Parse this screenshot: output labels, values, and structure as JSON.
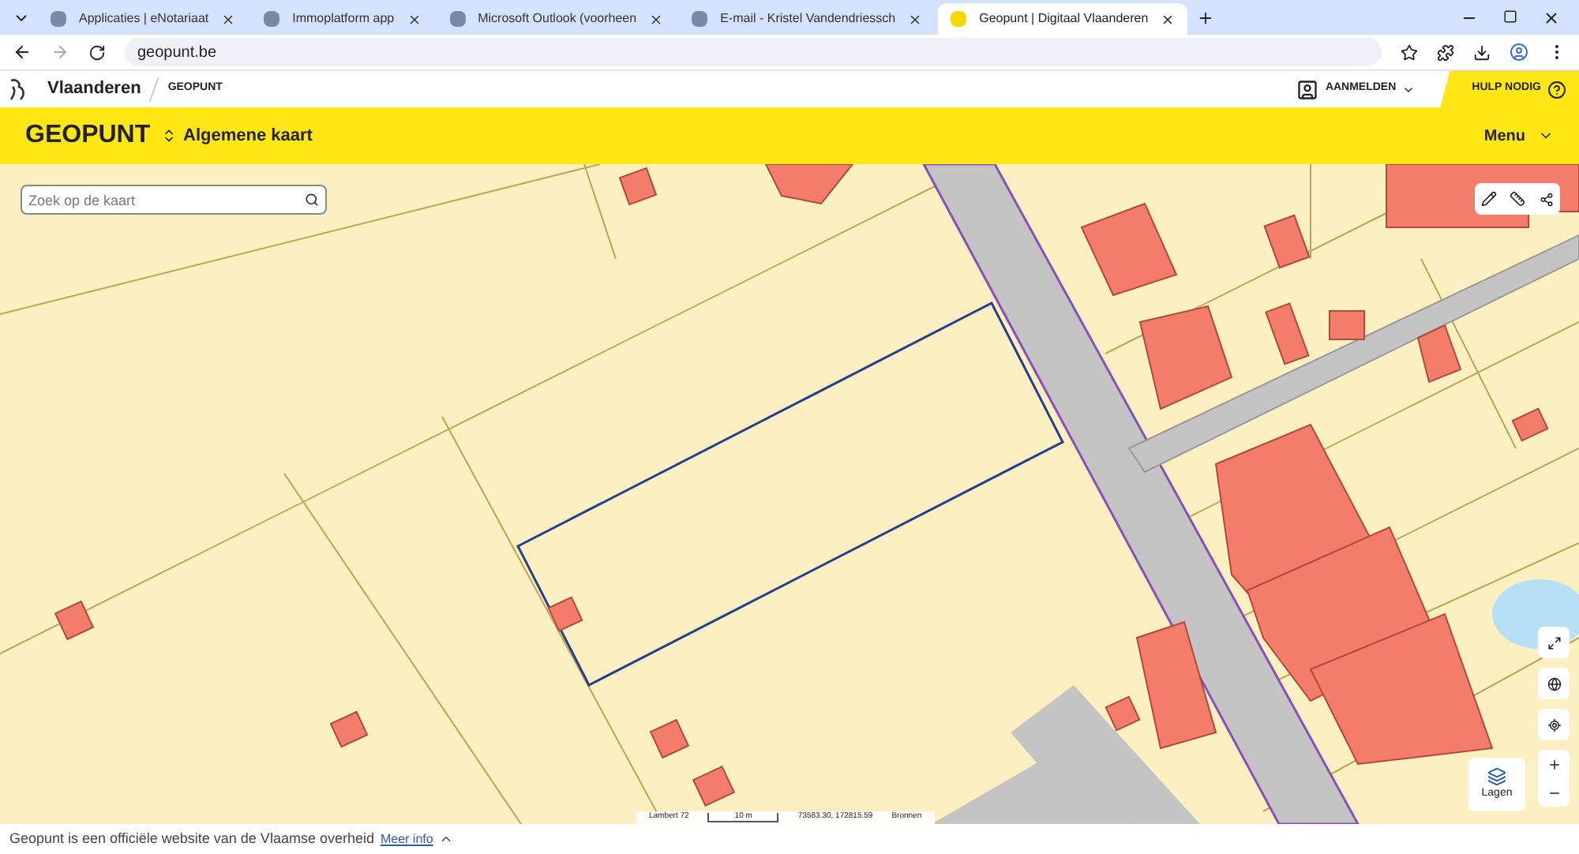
{
  "browser": {
    "tabs": [
      {
        "title": "Applicaties | eNotariaat",
        "selected": false
      },
      {
        "title": "Immoplatform app",
        "selected": false
      },
      {
        "title": "Microsoft Outlook (voorheen",
        "selected": false
      },
      {
        "title": "E-mail - Kristel Vandendriessch",
        "selected": false
      },
      {
        "title": "Geopunt | Digitaal Vlaanderen",
        "selected": true
      }
    ],
    "address": "geopunt.be"
  },
  "site_header": {
    "brand": "Vlaanderen",
    "site": "GEOPUNT",
    "login": "AANMELDEN",
    "help": "HULP NODIG"
  },
  "app_bar": {
    "title": "GEOPUNT",
    "map_selector": "Algemene kaart",
    "menu": "Menu"
  },
  "map": {
    "search": {
      "placeholder": "Zoek op de kaart"
    },
    "layers_button": "Lagen",
    "scale_line": {
      "projection": "Lambert 72",
      "scale": "10 m",
      "coordinates": "73583.30, 172815.59",
      "sources": "Bronnen"
    }
  },
  "footer": {
    "text": "Geopunt is een officiële website van de Vlaamse overheid",
    "link": "Meer info"
  }
}
